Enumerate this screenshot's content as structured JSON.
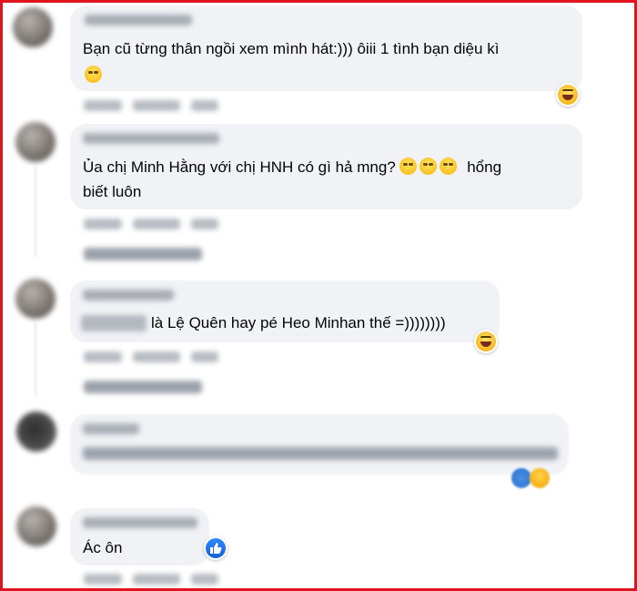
{
  "comments": [
    {
      "text_line1": "Bạn cũ từng thân ngồi xem mình hát:))) ôiii 1 tình bạn diệu kì",
      "text_line2_icon": "rofl-emoji-icon",
      "reaction": "laughing-reaction-icon"
    },
    {
      "text_line1": "Ủa chị Minh Hằng với chị HNH có gì hả mng?",
      "text_line1_tail": "hổng",
      "text_line2": "biết luôn",
      "emojis": [
        "rolling-eyes-emoji-icon",
        "rolling-eyes-emoji-icon",
        "rolling-eyes-emoji-icon"
      ]
    },
    {
      "text_line1": "là Lệ Quên hay pé Heo Minhan thế =))))))))",
      "reaction": "laughing-reaction-icon"
    },
    {
      "text_line1": "",
      "reaction": "like-haha-reaction-icon"
    },
    {
      "text_line1": "Ác ôn",
      "reaction": "like-reaction-icon"
    }
  ],
  "colors": {
    "frame": "#e0141e",
    "bubble": "#f0f2f5",
    "like_blue": "#1877f2",
    "text": "#050505"
  }
}
